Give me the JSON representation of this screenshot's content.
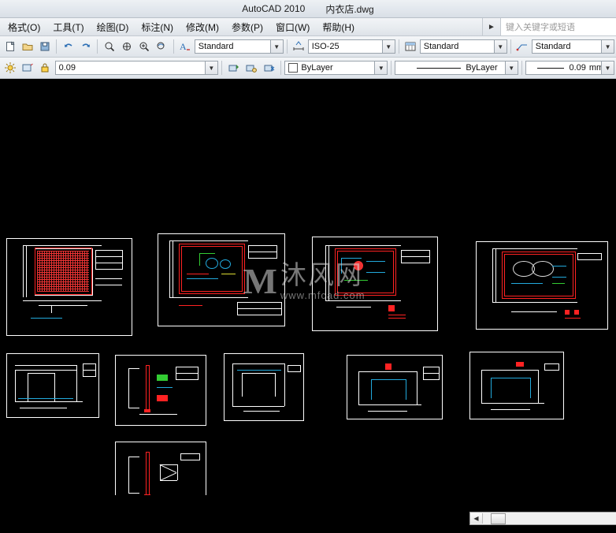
{
  "window": {
    "app_title": "AutoCAD 2010",
    "document_name": "内衣店.dwg"
  },
  "menubar": {
    "items": [
      {
        "label": "格式(O)"
      },
      {
        "label": "工具(T)"
      },
      {
        "label": "绘图(D)"
      },
      {
        "label": "标注(N)"
      },
      {
        "label": "修改(M)"
      },
      {
        "label": "参数(P)"
      },
      {
        "label": "窗口(W)"
      },
      {
        "label": "帮助(H)"
      }
    ],
    "overflow_icon": "chevron-right-icon",
    "search_placeholder": "键入关键字或短语"
  },
  "toolbar_top": {
    "text_style_icon": "text-style-icon",
    "text_style_value": "Standard",
    "dim_style_value": "ISO-25",
    "table_style_value": "Standard",
    "multileader_style_value": "Standard",
    "icons": [
      "new-icon",
      "open-icon",
      "save-icon",
      "undo-icon",
      "redo-icon",
      "zoom-window-icon",
      "pan-icon",
      "zoom-extents-icon",
      "zoom-previous-icon"
    ]
  },
  "toolbar_props": {
    "layer_state_value": "0.09",
    "layer_icons": [
      "layer-properties-icon",
      "layer-on-icon",
      "layer-lock-icon"
    ],
    "color_value": "ByLayer",
    "color_swatch": "#ffffff",
    "linetype_value": "ByLayer",
    "lineweight_value": "0.09",
    "lineweight_unit": "mm",
    "extra_icons": [
      "layer-previous-icon",
      "layer-isolate-icon",
      "layer-freeze-icon",
      "properties-icon"
    ]
  },
  "canvas": {
    "background": "#000000",
    "watermark_mark": "M",
    "watermark_cn": "沐风网",
    "watermark_url": "www.mfcad.com"
  },
  "status": {
    "scroll_left_icon": "triangle-left-icon"
  }
}
